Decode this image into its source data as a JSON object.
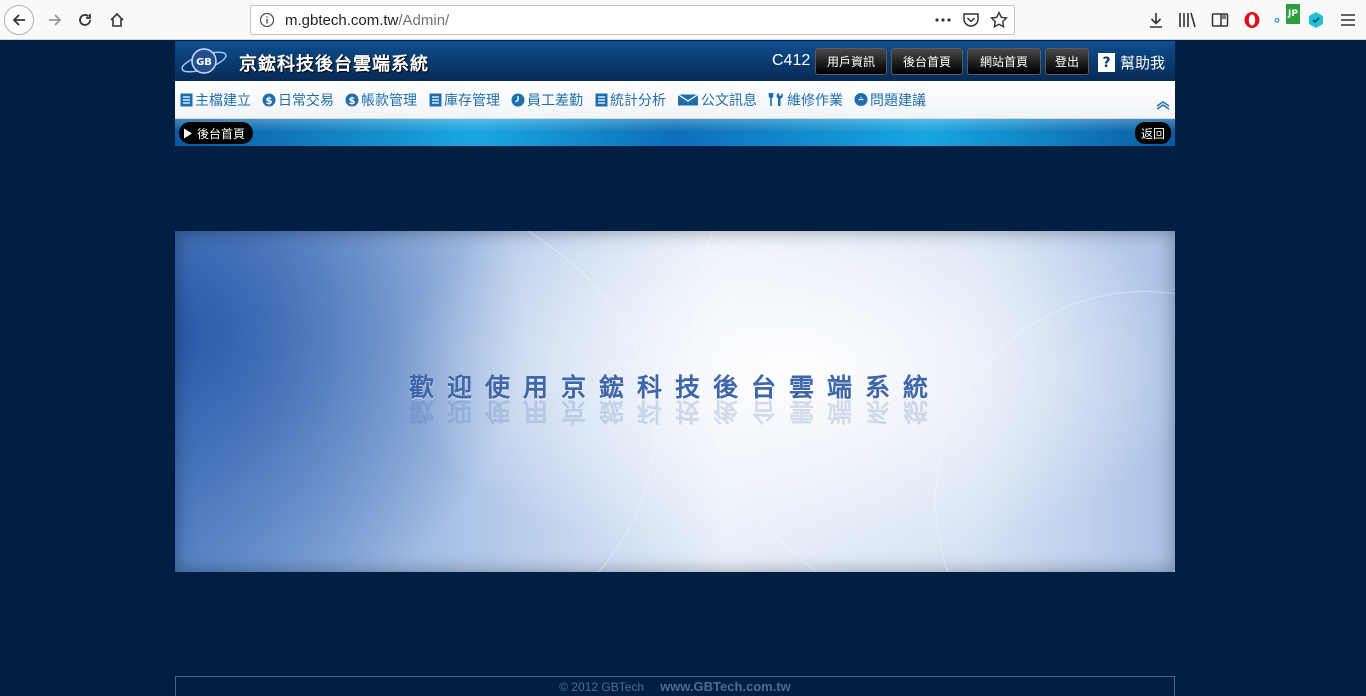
{
  "browser": {
    "url_host": "m.gbtech.com.tw",
    "url_path": "/Admin/",
    "jp_badge": "JP"
  },
  "header": {
    "site_title": "京鋐科技後台雲端系統",
    "logo_text": "GB",
    "user_code": "C412",
    "buttons": {
      "user_info": "用戶資訊",
      "admin_home": "後台首頁",
      "site_home": "網站首頁",
      "logout": "登出"
    },
    "help_symbol": "?",
    "help_label": "幫助我"
  },
  "menu": {
    "items": [
      {
        "label": "主檔建立",
        "icon": "list-icon"
      },
      {
        "label": "日常交易",
        "icon": "dollar-icon"
      },
      {
        "label": "帳款管理",
        "icon": "dollar-icon"
      },
      {
        "label": "庫存管理",
        "icon": "list-icon"
      },
      {
        "label": "員工差勤",
        "icon": "clock-icon"
      },
      {
        "label": "統計分析",
        "icon": "list-icon"
      },
      {
        "label": "公文訊息",
        "icon": "envelope-icon"
      },
      {
        "label": "維修作業",
        "icon": "tools-icon"
      },
      {
        "label": "問題建議",
        "icon": "chat-icon"
      }
    ]
  },
  "subbar": {
    "crumb": "後台首頁",
    "back": "返回"
  },
  "banner": {
    "welcome": "歡迎使用京鋐科技後台雲端系統"
  },
  "footer": {
    "copyright": "© 2012 GBTech",
    "website": "www.GBTech.com.tw"
  },
  "colors": {
    "page_background": "#001f42",
    "menu_text": "#1f6fae",
    "header_blue": "#0a3a70"
  }
}
